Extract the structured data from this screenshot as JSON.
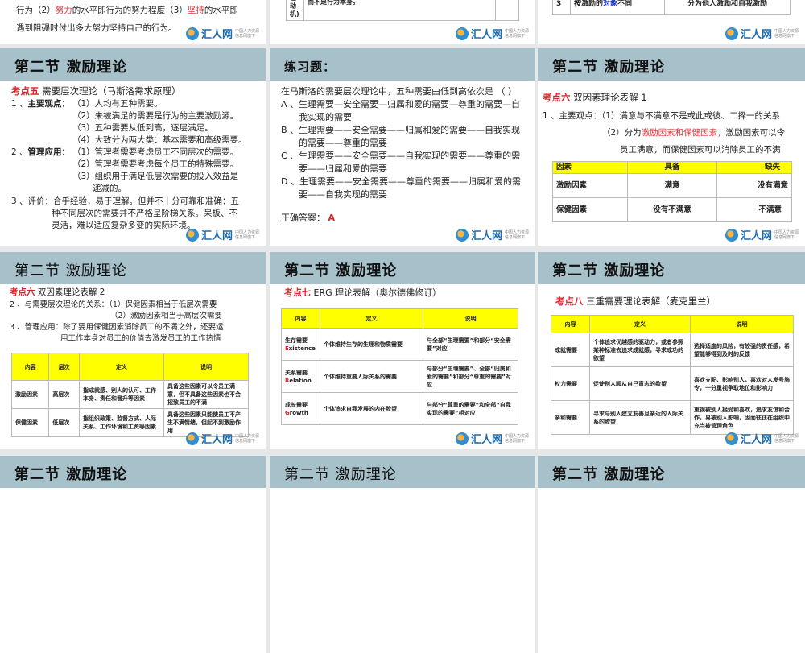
{
  "logo": {
    "name": "汇人网",
    "domain": "hr163.com",
    "tagline": "中国人力资源 信息网旗下"
  },
  "header": "第二节  激励理论",
  "top": {
    "left": {
      "line1_a": "行为（2）",
      "line1_b": "努力",
      "line1_c": "的水平即行为的努力程度（3）",
      "line1_d": "坚持",
      "line1_e": "的水平即",
      "line2": "遇到阻碍时付出多大努力坚持自己的行为。"
    },
    "middle": {
      "cell1": "外在动机)",
      "cell2": "而不是行为本身。"
    },
    "right": {
      "num": "3",
      "col1_a": "按激励的",
      "col1_b": "对象",
      "col1_c": "不同",
      "col2": "分为他人激励和自我激励"
    }
  },
  "s1": {
    "kp": "考点五",
    "title": " 需要层次理论（马斯洛需求原理）",
    "lines": [
      "1 、",
      "主要观点：",
      "（1）人均有五种需要。",
      "（2）未被满足的需要是行为的主要激励源。",
      "（3）五种需要从低到高，逐层满足。",
      "（4）大致分为两大类：基本需要和高级需要。",
      "2 、",
      "管理应用：",
      "（1）管理者需要考虑员工不同层次的需要。",
      "（2）管理者需要考虑每个员工的特殊需要。",
      "（3）组织用于满足低层次需要的投入效益是",
      "递减的。",
      "3 、",
      "评价：合乎经验，易于理解。但并不十分可靠和准确：五",
      "种不同层次的需要并不严格呈阶梯关系。呆板、不",
      "灵活，难以适应复杂多变的实际环境。"
    ]
  },
  "s2": {
    "title": "练习题：",
    "question": "在马斯洛的需要层次理论中，五种需要由低到高依次是 （    ）",
    "options": [
      "A 、生理需要—安全需要—归属和爱的需要—尊重的需要—自",
      "我实现的需要",
      "B 、生理需要——安全需要——归属和爱的需要——自我实现",
      "的需要——尊重的需要",
      "C 、生理需要——安全需要——自我实现的需要——尊重的需",
      "要——归属和爱的需要",
      "D 、生理需要——安全需要——尊重的需要——归属和爱的需",
      "要——自我实现的需要"
    ],
    "answer_label": "正确答案：",
    "answer": "A"
  },
  "s3": {
    "kp": "考点六",
    "title": " 双因素理论表解 1",
    "l1": "1 、主要观点：（1）满意与不满意不是或此或彼、二择一的关系",
    "l2a": "（2）分为",
    "l2b": "激励因素和保健因素",
    "l2c": "，激励因素可以令",
    "l3": "员工满意，而保健因素可以消除员工的不满",
    "table": {
      "headers": [
        "因素",
        "具备",
        "缺失"
      ],
      "rows": [
        [
          "激励因素",
          "满意",
          "没有满意"
        ],
        [
          "保健因素",
          "没有不满意",
          "不满意"
        ]
      ]
    }
  },
  "s4": {
    "kp": "考点六",
    "title": " 双因素理论表解 2",
    "lines": [
      "2 、与需要层次理论的关系：（1）保健因素相当于低层次需要",
      "（2）激励因素相当于高层次需要",
      "3 、管理应用：除了要用保健因素消除员工的不满之外，还要运",
      "用工作本身对员工的价值去激发员工的工作热情"
    ],
    "table": {
      "headers": [
        "内容",
        "层次",
        "定义",
        "说明"
      ],
      "rows": [
        [
          "激励因素",
          "高层次",
          "指成就感、别人的认可、工作本身、责任和晋升等因素",
          "具备这些因素可以令员工满意，但不具备这些因素也不会招致员工的不满"
        ],
        [
          "保健因素",
          "低层次",
          "指组织政策、监督方式、人际关系、工作环境和工资等因素",
          "具备这些因素只能使员工不产生不满情绪，但起不到激励作用"
        ]
      ]
    }
  },
  "s5": {
    "kp": "考点七",
    "title": " ERG 理论表解（奥尔德佛修订）",
    "table": {
      "headers": [
        "内容",
        "定义",
        "说明"
      ],
      "rows": [
        [
          "生存需要",
          "E",
          "xistence",
          "个体维持生存的生理和物质需要",
          "与全部“生理需要”和部分“安全需要”对应"
        ],
        [
          "关系需要",
          "R",
          "elation",
          "个体维持重要人际关系的需要",
          "与部分“生理需要”、全部“归属和爱的需要”和部分“尊重的需要”对应"
        ],
        [
          "成长需要",
          "G",
          "rowth",
          "个体追求自我发展的内在欲望",
          "与部分“尊重的需要”和全部“自我实现的需要”相对应"
        ]
      ]
    }
  },
  "s6": {
    "kp": "考点八",
    "title": " 三重需要理论表解（麦克里兰）",
    "table": {
      "headers": [
        "内容",
        "定义",
        "说明"
      ],
      "rows": [
        [
          "成就需要",
          "个体追求优越感的驱动力，或者参照某种标准去追求成就感，寻求成功的欲望",
          "选择适度的风险，有较强的责任感，希望能够得到及时的反馈"
        ],
        [
          "权力需要",
          "促使别人顺从自己意志的欲望",
          "喜欢支配、影响别人，喜欢对人发号施令，十分重视争取地位和影响力"
        ],
        [
          "亲和需要",
          "寻求与别人建立友善且亲近的人际关系的欲望",
          "重视被别人接受和喜欢，追求友谊和合作，易被别人影响，因而往往在组织中充当被管理角色"
        ]
      ]
    }
  }
}
